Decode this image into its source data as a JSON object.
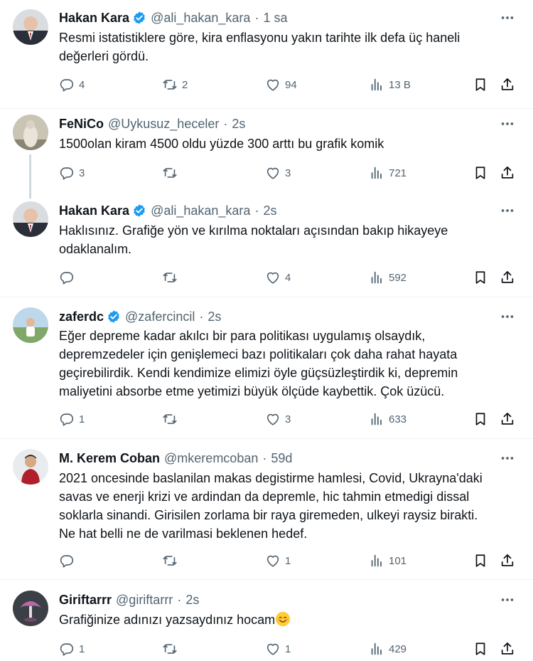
{
  "tweets": [
    {
      "name": "Hakan Kara",
      "verified": true,
      "handle": "@ali_hakan_kara",
      "time": "1 sa",
      "lines": [
        "Resmi istatistiklere göre, kira enflasyonu yakın tarihte ilk defa üç haneli",
        "değerleri gördü."
      ],
      "replies": "4",
      "retweets": "2",
      "likes": "94",
      "views": "13 B"
    },
    {
      "name": "FeNiCo",
      "verified": false,
      "handle": "@Uykusuz_heceler",
      "time": "2s",
      "lines": [
        "1500olan kiram 4500 oldu yüzde 300 arttı bu grafik komik"
      ],
      "replies": "3",
      "retweets": "",
      "likes": "3",
      "views": "721"
    },
    {
      "name": "Hakan Kara",
      "verified": true,
      "handle": "@ali_hakan_kara",
      "time": "2s",
      "lines": [
        "Haklısınız. Grafiğe yön ve kırılma noktaları açısından bakıp hikayeye",
        "odaklanalım."
      ],
      "replies": "",
      "retweets": "",
      "likes": "4",
      "views": "592"
    },
    {
      "name": "zaferdc",
      "verified": true,
      "handle": "@zafercincil",
      "time": "2s",
      "lines": [
        "Eğer depreme kadar akılcı bir para politikası uygulamış olsaydık,",
        "depremzedeler için genişlemeci bazı politikaları çok daha rahat hayata",
        "geçirebilirdik. Kendi kendimize elimizi öyle güçsüzleştirdik ki, depremin",
        "maliyetini absorbe etme yetimizi büyük ölçüde kaybettik. Çok üzücü."
      ],
      "replies": "1",
      "retweets": "",
      "likes": "3",
      "views": "633"
    },
    {
      "name": "M. Kerem Coban",
      "verified": false,
      "handle": "@mkeremcoban",
      "time": "59d",
      "lines": [
        "2021 oncesinde baslanilan makas degistirme hamlesi, Covid, Ukrayna'daki",
        "savas ve enerji krizi ve ardindan da depremle, hic tahmin etmedigi dissal",
        "soklarla sinandi. Girisilen zorlama bir raya giremeden, ulkeyi raysiz birakti.",
        "Ne hat belli ne de varilmasi beklenen hedef."
      ],
      "replies": "",
      "retweets": "",
      "likes": "1",
      "views": "101"
    },
    {
      "name": "Giriftarrr",
      "verified": false,
      "handle": "@giriftarrr",
      "time": "2s",
      "lines": [
        "Grafiğinize adınızı yazsaydınız hocam"
      ],
      "emoji": "smiling-face-emoji",
      "replies": "1",
      "retweets": "",
      "likes": "1",
      "views": "429"
    }
  ],
  "icons": {
    "reply": "reply-icon",
    "retweet": "retweet-icon",
    "like": "like-icon",
    "views": "views-icon",
    "bookmark": "bookmark-icon",
    "share": "share-icon",
    "more": "more-icon",
    "verified": "verified-badge-icon"
  },
  "colors": {
    "text": "#0f1419",
    "secondary": "#536471",
    "verified": "#1d9bf0",
    "separator": "#eff3f4",
    "thread_line": "#cfd9de"
  }
}
